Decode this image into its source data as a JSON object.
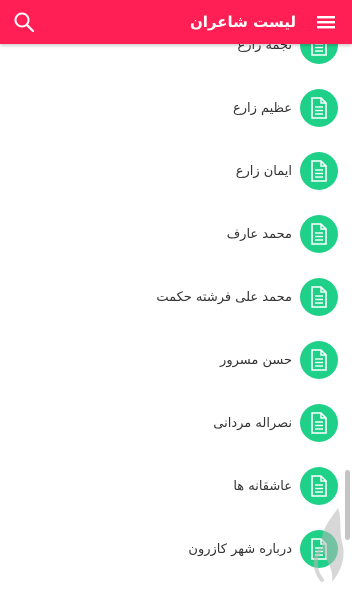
{
  "header": {
    "title": "لیست شاعران",
    "menu_icon": "hamburger-menu-icon",
    "search_icon": "search-icon",
    "accent_color": "#ff1f55"
  },
  "list": {
    "item_icon": "document-icon",
    "icon_color": "#1fd089",
    "items": [
      {
        "label": "نجمه زارع"
      },
      {
        "label": "عظیم زارع"
      },
      {
        "label": "ایمان زارع"
      },
      {
        "label": "محمد عارف"
      },
      {
        "label": "محمد علی فرشته حکمت"
      },
      {
        "label": "حسن مسرور"
      },
      {
        "label": "نصراله مردانی"
      },
      {
        "label": "عاشقانه ها"
      },
      {
        "label": "درباره شهر کازرون"
      }
    ]
  }
}
